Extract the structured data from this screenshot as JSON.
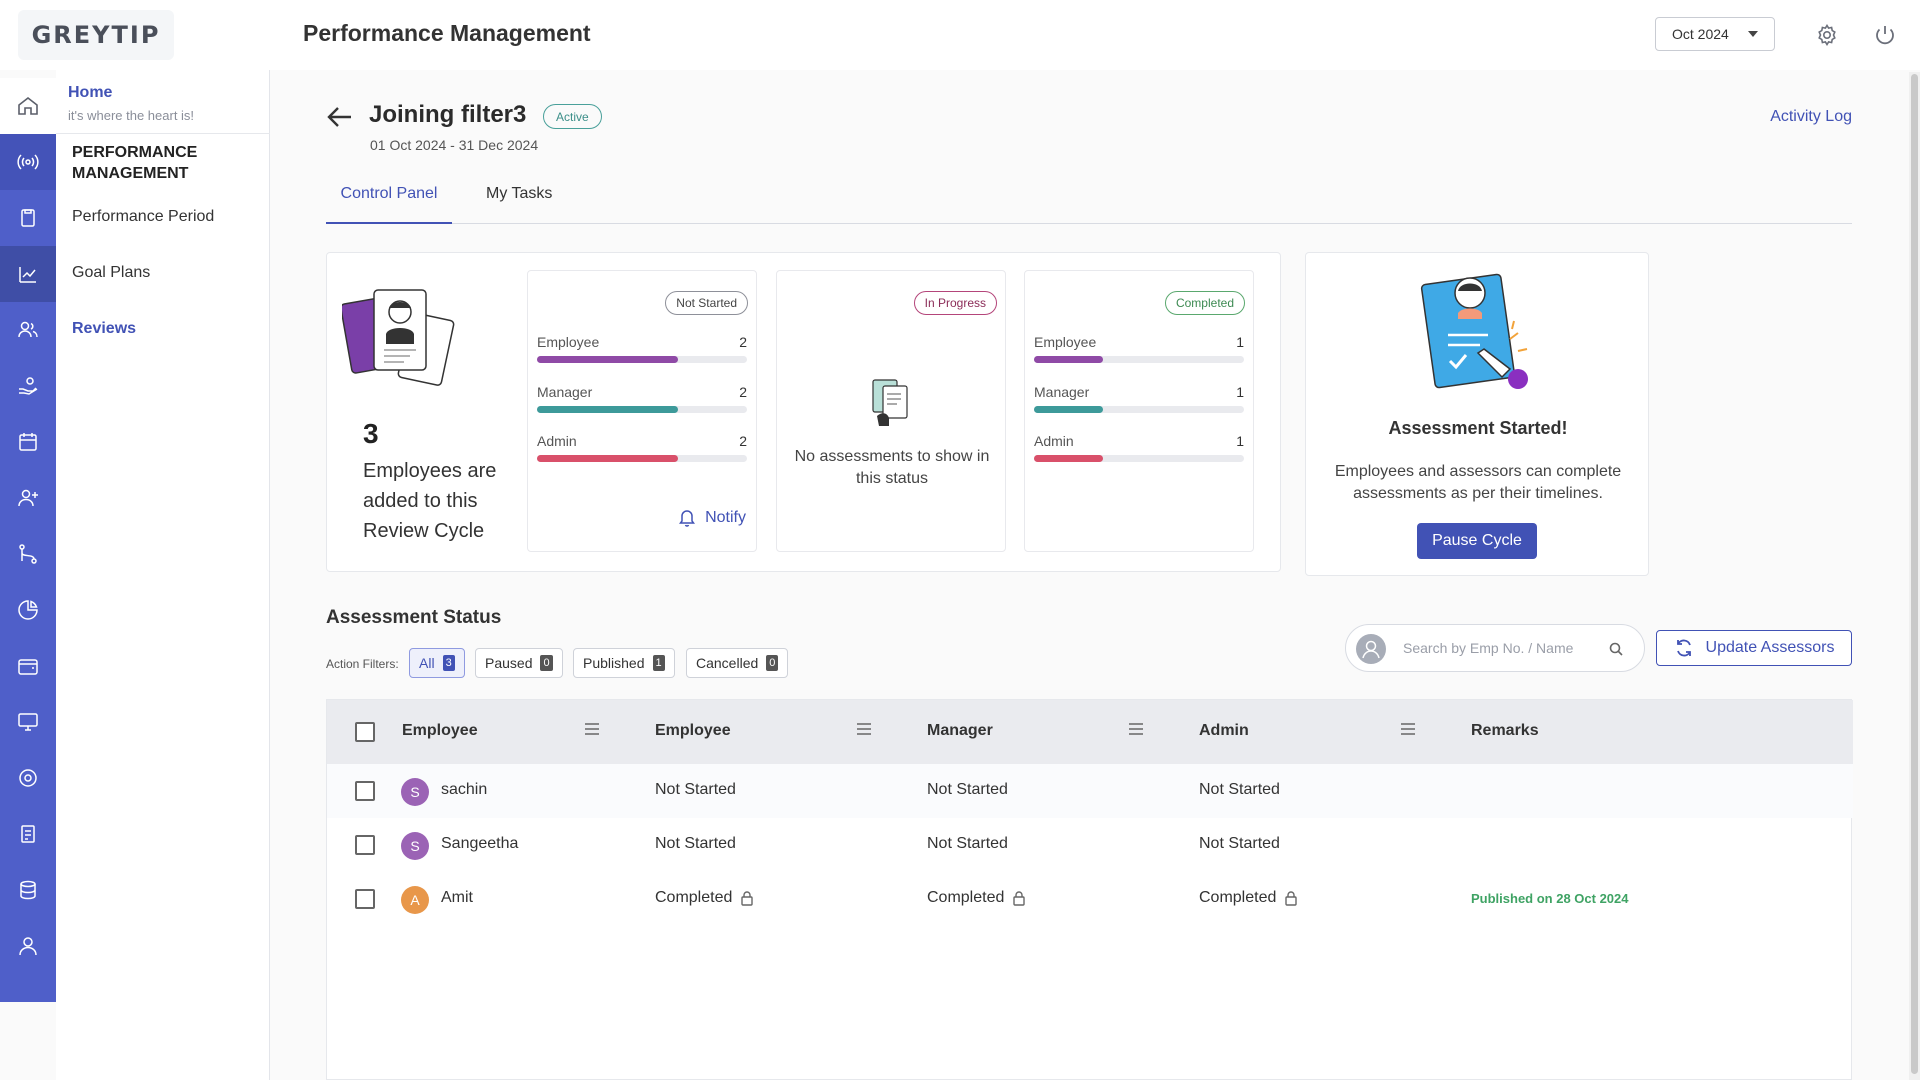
{
  "header": {
    "logo_text": "GREYTIP",
    "title": "Performance Management",
    "period": "Oct 2024"
  },
  "sidenav": {
    "home_title": "Home",
    "home_subtitle": "it's where the heart is!",
    "section": "PERFORMANCE MANAGEMENT",
    "items": [
      {
        "label": "Performance Period"
      },
      {
        "label": "Goal Plans"
      },
      {
        "label": "Reviews"
      }
    ]
  },
  "cycle": {
    "title": "Joining filter3",
    "status": "Active",
    "dates": "01 Oct 2024 - 31 Dec 2024",
    "activity_log": "Activity Log"
  },
  "tabs": [
    "Control Panel",
    "My Tasks"
  ],
  "summary": {
    "count": "3",
    "description": "Employees are added to this Review Cycle"
  },
  "status_cards": [
    {
      "badge": "Not Started",
      "rows": [
        {
          "label": "Employee",
          "value": "2",
          "fill": 0.67
        },
        {
          "label": "Manager",
          "value": "2",
          "fill": 0.67
        },
        {
          "label": "Admin",
          "value": "2",
          "fill": 0.67
        }
      ],
      "action": "Notify"
    },
    {
      "badge": "In Progress",
      "empty_text": "No assessments to show in this status"
    },
    {
      "badge": "Completed",
      "rows": [
        {
          "label": "Employee",
          "value": "1",
          "fill": 0.33
        },
        {
          "label": "Manager",
          "value": "1",
          "fill": 0.33
        },
        {
          "label": "Admin",
          "value": "1",
          "fill": 0.33
        }
      ]
    }
  ],
  "started": {
    "title": "Assessment Started!",
    "description": "Employees and assessors can complete assessments as per their timelines.",
    "button": "Pause Cycle"
  },
  "assessment": {
    "title": "Assessment Status",
    "filters_label": "Action Filters:",
    "filters": [
      {
        "label": "All",
        "count": "3"
      },
      {
        "label": "Paused",
        "count": "0"
      },
      {
        "label": "Published",
        "count": "1"
      },
      {
        "label": "Cancelled",
        "count": "0"
      }
    ],
    "search_placeholder": "Search by Emp No. / Name",
    "update_button": "Update Assessors"
  },
  "table": {
    "columns": [
      "Employee",
      "Employee",
      "Manager",
      "Admin",
      "Remarks"
    ],
    "rows": [
      {
        "initial": "S",
        "name": "sachin",
        "employee": "Not Started",
        "manager": "Not Started",
        "admin": "Not Started",
        "remarks": ""
      },
      {
        "initial": "S",
        "name": "Sangeetha",
        "employee": "Not Started",
        "manager": "Not Started",
        "admin": "Not Started",
        "remarks": ""
      },
      {
        "initial": "A",
        "name": "Amit",
        "employee": "Completed",
        "manager": "Completed",
        "admin": "Completed",
        "remarks": "Published on 28 Oct 2024"
      }
    ]
  },
  "colors": {
    "accent": "#4152b5",
    "rail": "#4f5fc9",
    "bar_employee": "#8f4aa6",
    "bar_manager": "#3d9a9a",
    "bar_admin": "#d9506a",
    "avatar_s": "#9b63b5",
    "avatar_a": "#e8974a",
    "published": "#3fa364"
  }
}
